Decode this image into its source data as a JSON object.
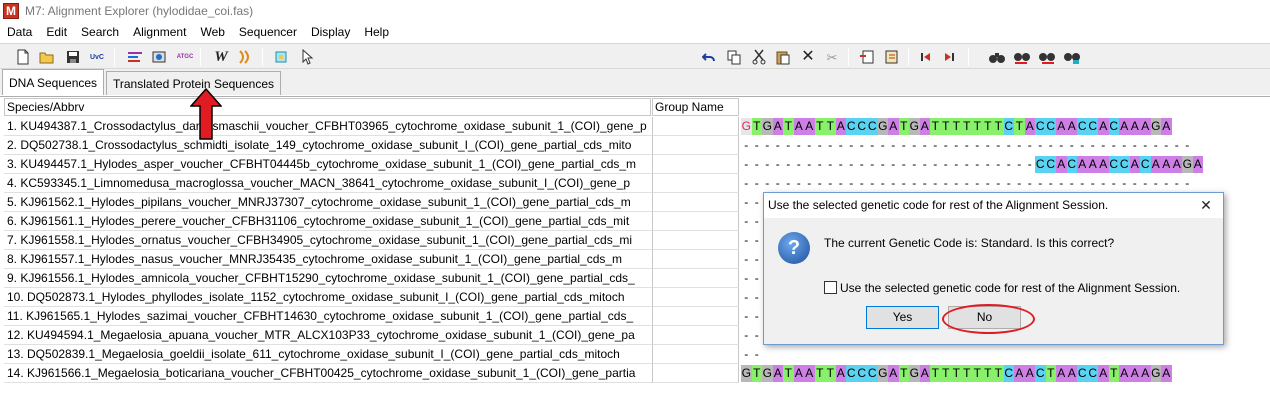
{
  "window": {
    "app_icon_letter": "M",
    "title": "M7: Alignment Explorer (hylodidae_coi.fas)"
  },
  "menu": [
    "Data",
    "Edit",
    "Search",
    "Alignment",
    "Web",
    "Sequencer",
    "Display",
    "Help"
  ],
  "toolbar": {
    "left_icons": [
      "new-file-icon",
      "open-folder-icon",
      "save-icon",
      "uvc-icon",
      "align-icon",
      "dna-db-icon",
      "atgc-icon",
      "w-icon",
      "muscle-icon",
      "highlight-icon",
      "cursor-icon"
    ],
    "right_icons": [
      "undo-icon",
      "copy-icon",
      "cut-icon",
      "paste-icon",
      "delete-icon",
      "scissors-gray-icon",
      "insert-seq-icon",
      "insert-seq2-icon",
      "move-left-icon",
      "move-right-icon",
      "find-icon",
      "find-prev-icon",
      "find-next-icon",
      "find-motif-icon"
    ]
  },
  "tabs": {
    "dna": "DNA Sequences",
    "protein": "Translated Protein Sequences"
  },
  "grid": {
    "header_species": "Species/Abbrv",
    "header_group": "Group Name",
    "rows": [
      {
        "name": "1. KU494387.1_Crossodactylus_dantasmaschii_voucher_CFBHT03965_cytochrome_oxidase_subunit_1_(COI)_gene_p",
        "seq": "GTGATAATTACCCGATGATTTTTTTCTACCAACCACAAAGA",
        "first_highlight": true
      },
      {
        "name": "2. DQ502738.1_Crossodactylus_schmidti_isolate_149_cytochrome_oxidase_subunit_I_(COI)_gene_partial_cds_mito",
        "seq": "-------------------------------------------"
      },
      {
        "name": "3. KU494457.1_Hylodes_asper_voucher_CFBHT04445b_cytochrome_oxidase_subunit_1_(COI)_gene_partial_cds_m",
        "seq": "----------------------------CCACAAACCACAAAGA"
      },
      {
        "name": "4. KC593345.1_Limnomedusa_macroglossa_voucher_MACN_38641_cytochrome_oxidase_subunit_I_(COI)_gene_p",
        "seq": "-------------------------------------------"
      },
      {
        "name": "5. KJ961562.1_Hylodes_pipilans_voucher_MNRJ37307_cytochrome_oxidase_subunit_1_(COI)_gene_partial_cds_m",
        "seq": "--"
      },
      {
        "name": "6. KJ961561.1_Hylodes_perere_voucher_CFBH31106_cytochrome_oxidase_subunit_1_(COI)_gene_partial_cds_mit",
        "seq": "--"
      },
      {
        "name": "7. KJ961558.1_Hylodes_ornatus_voucher_CFBH34905_cytochrome_oxidase_subunit_1_(COI)_gene_partial_cds_mi",
        "seq": "--"
      },
      {
        "name": "8. KJ961557.1_Hylodes_nasus_voucher_MNRJ35435_cytochrome_oxidase_subunit_1_(COI)_gene_partial_cds_m",
        "seq": "--"
      },
      {
        "name": "9. KJ961556.1_Hylodes_amnicola_voucher_CFBHT15290_cytochrome_oxidase_subunit_1_(COI)_gene_partial_cds_",
        "seq": "--"
      },
      {
        "name": "10. DQ502873.1_Hylodes_phyllodes_isolate_1152_cytochrome_oxidase_subunit_I_(COI)_gene_partial_cds_mitoch",
        "seq": "--"
      },
      {
        "name": "11. KJ961565.1_Hylodes_sazimai_voucher_CFBHT14630_cytochrome_oxidase_subunit_1_(COI)_gene_partial_cds_",
        "seq": "--"
      },
      {
        "name": "12. KU494594.1_Megaelosia_apuana_voucher_MTR_ALCX103P33_cytochrome_oxidase_subunit_1_(COI)_gene_pa",
        "seq": "--"
      },
      {
        "name": "13. DQ502839.1_Megaelosia_goeldii_isolate_611_cytochrome_oxidase_subunit_I_(COI)_gene_partial_cds_mitoch",
        "seq": "--"
      },
      {
        "name": "14. KJ961566.1_Megaelosia_boticariana_voucher_CFBHT00425_cytochrome_oxidase_subunit_1_(COI)_gene_partia",
        "seq": "GTGATAATTACCCGATGATTTTTTTCAACTAACCATAAAGA"
      }
    ]
  },
  "dialog": {
    "title": "Use the selected genetic code for rest of the Alignment Session.",
    "close_glyph": "✕",
    "icon_glyph": "?",
    "message": "The current Genetic Code is: Standard. Is this correct?",
    "checkbox_label": "Use the selected genetic code for rest of the Alignment Session.",
    "yes": "Yes",
    "no": "No"
  },
  "colors": {
    "A": "#cd7fe6",
    "T": "#88f06a",
    "C": "#5ad3f2",
    "G": "#b8b8b8",
    "annotation": "#e01b22"
  }
}
